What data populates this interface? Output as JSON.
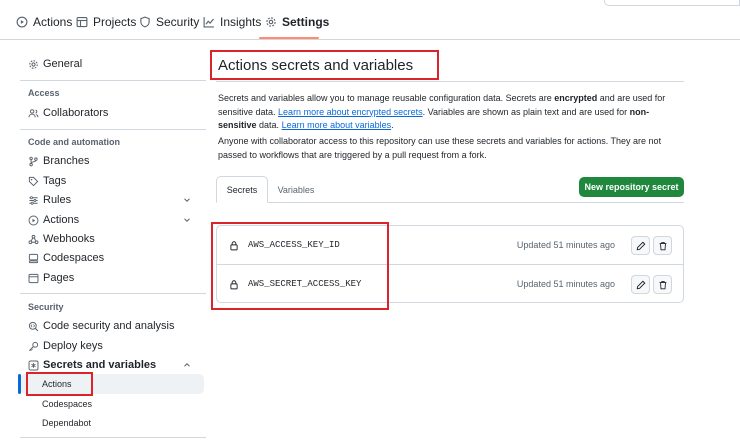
{
  "top_tabs": [
    {
      "label": "Actions",
      "icon": "play-circle-icon"
    },
    {
      "label": "Projects",
      "icon": "table-icon"
    },
    {
      "label": "Security",
      "icon": "shield-icon"
    },
    {
      "label": "Insights",
      "icon": "graph-icon"
    },
    {
      "label": "Settings",
      "icon": "gear-icon",
      "active": true
    }
  ],
  "sidebar": {
    "general": "General",
    "access_heading": "Access",
    "collaborators": "Collaborators",
    "code_heading": "Code and automation",
    "branches": "Branches",
    "tags": "Tags",
    "rules": "Rules",
    "actions": "Actions",
    "webhooks": "Webhooks",
    "codespaces": "Codespaces",
    "pages": "Pages",
    "security_heading": "Security",
    "code_security": "Code security and analysis",
    "deploy_keys": "Deploy keys",
    "secrets_variables": "Secrets and variables",
    "sub_actions": "Actions",
    "sub_codespaces": "Codespaces",
    "sub_dependabot": "Dependabot"
  },
  "main": {
    "title": "Actions secrets and variables",
    "intro_1": "Secrets and variables allow you to manage reusable configuration data. Secrets are ",
    "intro_encrypted": "encrypted",
    "intro_2": " and are used for sensitive data. ",
    "link_secrets": "Learn more about encrypted secrets",
    "intro_3": ". Variables are shown as plain text and are used for ",
    "intro_nonsensitive": "non-sensitive",
    "intro_4": " data. ",
    "link_variables": "Learn more about variables",
    "intro_5": ".",
    "collab_text": "Anyone with collaborator access to this repository can use these secrets and variables for actions. They are not passed to workflows that are triggered by a pull request from a fork.",
    "tab_secrets": "Secrets",
    "tab_variables": "Variables",
    "new_button": "New repository secret",
    "secrets": [
      {
        "name": "AWS_ACCESS_KEY_ID",
        "updated": "Updated 51 minutes ago"
      },
      {
        "name": "AWS_SECRET_ACCESS_KEY",
        "updated": "Updated 51 minutes ago"
      }
    ]
  },
  "colors": {
    "accent_green": "#1f883d",
    "link_blue": "#0969da",
    "annotation_red": "#d9242b",
    "tab_underline": "#fd8c73"
  }
}
